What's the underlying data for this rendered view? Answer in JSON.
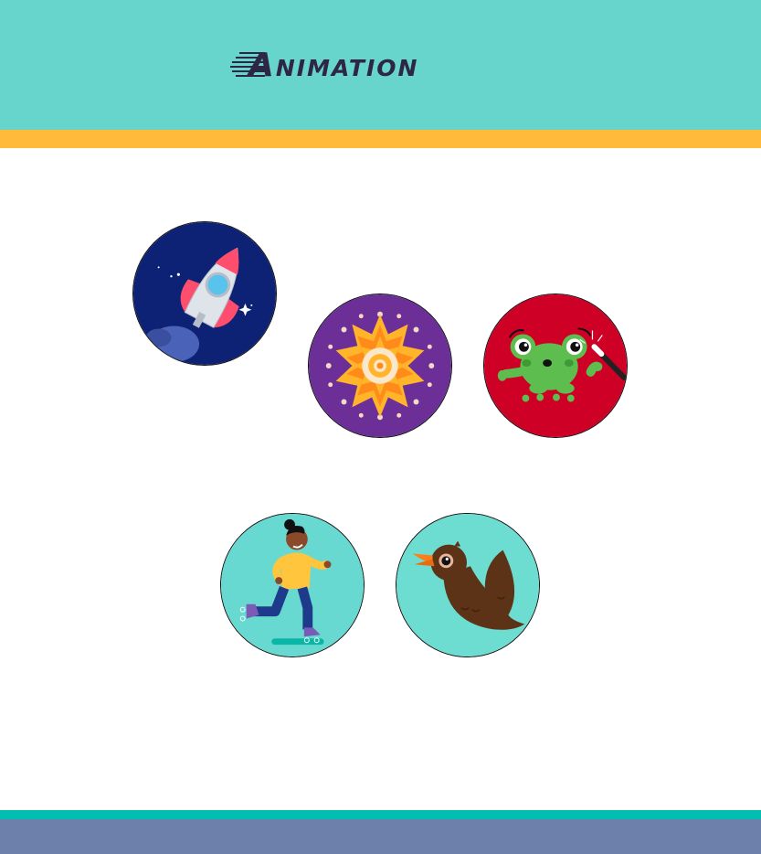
{
  "header": {
    "title": "Animation",
    "background_color": "#67d5cb",
    "stripe_color": "#ffb93b"
  },
  "projects": [
    {
      "icon": "rocket-icon",
      "background_color": "#0d2274"
    },
    {
      "icon": "mandala-icon",
      "background_color": "#6b2f97"
    },
    {
      "icon": "frog-icon",
      "background_color": "#cf0026"
    },
    {
      "icon": "roller-skater-icon",
      "background_color": "#67d9d1"
    },
    {
      "icon": "bird-icon",
      "background_color": "#6ddcd1"
    }
  ],
  "footer": {
    "stripe_color": "#00bfb0",
    "background_color": "#6d80ac"
  }
}
